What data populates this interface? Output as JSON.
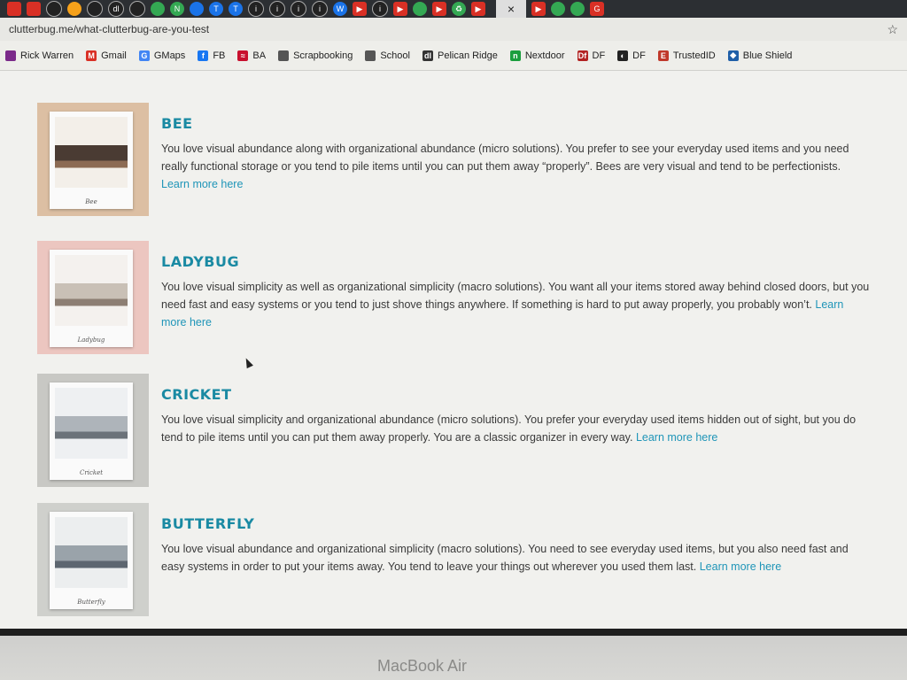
{
  "browser": {
    "url": "clutterbug.me/what-clutterbug-are-you-test",
    "tab_close_label": "×",
    "tab_icons": [
      {
        "name": "tab-icon-red",
        "style": "r",
        "glyph": ""
      },
      {
        "name": "tab-icon-red",
        "style": "r",
        "glyph": ""
      },
      {
        "name": "tab-icon-dark",
        "style": "k",
        "glyph": ""
      },
      {
        "name": "tab-icon-orange",
        "style": "o",
        "glyph": ""
      },
      {
        "name": "tab-icon-dark",
        "style": "k",
        "glyph": ""
      },
      {
        "name": "tab-icon-dark",
        "style": "k",
        "glyph": "dl"
      },
      {
        "name": "tab-icon-dark",
        "style": "k",
        "glyph": ""
      },
      {
        "name": "tab-icon-green",
        "style": "g",
        "glyph": ""
      },
      {
        "name": "tab-icon-green",
        "style": "g",
        "glyph": "N"
      },
      {
        "name": "tab-icon-blue",
        "style": "b",
        "glyph": ""
      },
      {
        "name": "tab-icon-blue",
        "style": "b",
        "glyph": "T"
      },
      {
        "name": "tab-icon-blue",
        "style": "b",
        "glyph": "T"
      },
      {
        "name": "tab-icon-info",
        "style": "k",
        "glyph": "i"
      },
      {
        "name": "tab-icon-info",
        "style": "k",
        "glyph": "i"
      },
      {
        "name": "tab-icon-info",
        "style": "k",
        "glyph": "i"
      },
      {
        "name": "tab-icon-info",
        "style": "k",
        "glyph": "i"
      },
      {
        "name": "tab-icon-w",
        "style": "b",
        "glyph": "W"
      },
      {
        "name": "tab-icon-youtube",
        "style": "r",
        "glyph": "▶"
      },
      {
        "name": "tab-icon-info",
        "style": "k",
        "glyph": "i"
      },
      {
        "name": "tab-icon-youtube",
        "style": "r",
        "glyph": "▶"
      },
      {
        "name": "tab-icon-maps",
        "style": "g",
        "glyph": ""
      },
      {
        "name": "tab-icon-youtube",
        "style": "r",
        "glyph": "▶"
      },
      {
        "name": "tab-icon-recycle",
        "style": "g",
        "glyph": "♻"
      },
      {
        "name": "tab-icon-youtube",
        "style": "r",
        "glyph": "▶"
      }
    ],
    "trailing_icons": [
      {
        "name": "tab-icon-youtube",
        "style": "r",
        "glyph": "▶"
      },
      {
        "name": "tab-icon-green",
        "style": "g",
        "glyph": ""
      },
      {
        "name": "tab-icon-green",
        "style": "g",
        "glyph": ""
      },
      {
        "name": "tab-icon-google",
        "style": "r",
        "glyph": "G"
      }
    ]
  },
  "bookmarks": [
    {
      "label": "Rick Warren",
      "icon": "bookmark-icon",
      "color": "#7b2a8a",
      "glyph": ""
    },
    {
      "label": "Gmail",
      "icon": "gmail-icon",
      "color": "#d93025",
      "glyph": "M"
    },
    {
      "label": "GMaps",
      "icon": "google-icon",
      "color": "#4285f4",
      "glyph": "G"
    },
    {
      "label": "FB",
      "icon": "facebook-icon",
      "color": "#1877f2",
      "glyph": "f"
    },
    {
      "label": "BA",
      "icon": "ba-icon",
      "color": "#c8102e",
      "glyph": "≈"
    },
    {
      "label": "Scrapbooking",
      "icon": "folder-icon",
      "color": "#555555",
      "glyph": ""
    },
    {
      "label": "School",
      "icon": "folder-icon",
      "color": "#555555",
      "glyph": ""
    },
    {
      "label": "Pelican Ridge",
      "icon": "dl-icon",
      "color": "#333333",
      "glyph": "dl"
    },
    {
      "label": "Nextdoor",
      "icon": "nextdoor-icon",
      "color": "#1b9e3e",
      "glyph": "n"
    },
    {
      "label": "DF",
      "icon": "df-icon",
      "color": "#b22222",
      "glyph": "Df"
    },
    {
      "label": "DF",
      "icon": "globe-icon",
      "color": "#222222",
      "glyph": "◐"
    },
    {
      "label": "TrustedID",
      "icon": "trustedid-icon",
      "color": "#c0392b",
      "glyph": "E"
    },
    {
      "label": "Blue Shield",
      "icon": "shield-icon",
      "color": "#1f5fa8",
      "glyph": "◆"
    }
  ],
  "types": [
    {
      "title": "BEE",
      "description": "You love visual abundance along with organizational abundance (micro solutions). You prefer to see your everyday used items and you need really functional storage or you tend to pile items until you can put them away “properly”. Bees are very visual and tend to be perfectionists.",
      "link": "Learn more here",
      "caption": "Bee",
      "bg_color": "#dcbfa3",
      "photo_colors": [
        "#f3efe9",
        "#4a3b33",
        "#8c6b54"
      ]
    },
    {
      "title": "LADYBUG",
      "description": "You love visual simplicity as well as organizational simplicity (macro solutions). You want all your items stored away behind closed doors, but you need fast and easy systems or you tend to just shove things anywhere. If something is hard to put away properly, you probably won’t.",
      "link": "Learn more here",
      "caption": "Ladybug",
      "bg_color": "#ecc6c0",
      "photo_colors": [
        "#f4f1ee",
        "#c9c0b6",
        "#8d7f74"
      ]
    },
    {
      "title": "CRICKET",
      "description": "You love visual simplicity and organizational abundance (micro solutions). You prefer your everyday used items hidden out of sight, but you do tend to pile items until you can put them away properly. You are a classic organizer in every way.",
      "link": "Learn more here",
      "caption": "Cricket",
      "bg_color": "#c8c8c4",
      "photo_colors": [
        "#eef0f2",
        "#aeb4ba",
        "#6b7279"
      ]
    },
    {
      "title": "BUTTERFLY",
      "description": "You love visual abundance and organizational simplicity (macro solutions). You need to see everyday used items, but you also need fast and easy systems in order to put your items away. You tend to leave your things out wherever you used them last.",
      "link": "Learn more here",
      "caption": "Butterfly",
      "bg_color": "#cfd0cc",
      "photo_colors": [
        "#eceeef",
        "#9aa3aa",
        "#5d6670"
      ]
    }
  ],
  "device": {
    "brand": "MacBook Air"
  }
}
